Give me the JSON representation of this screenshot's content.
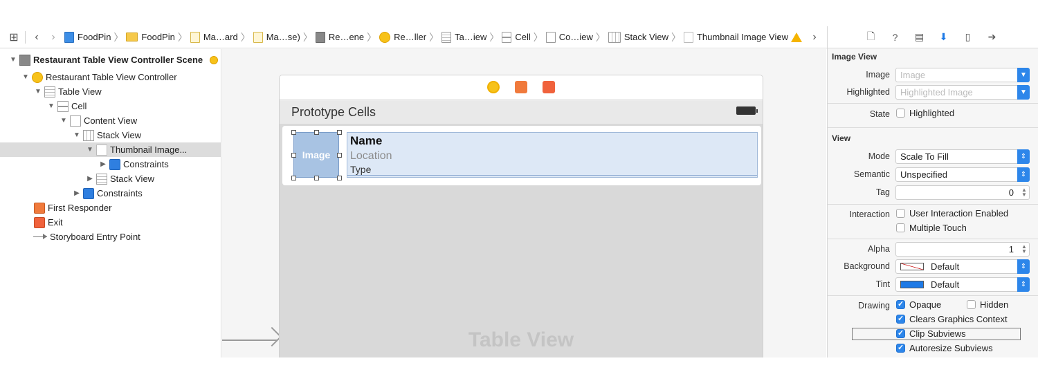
{
  "breadcrumbs": [
    "FoodPin",
    "FoodPin",
    "Ma…ard",
    "Ma…se)",
    "Re…ene",
    "Re…ller",
    "Ta…iew",
    "Cell",
    "Co…iew",
    "Stack View",
    "Thumbnail Image View"
  ],
  "outline": {
    "items": [
      {
        "label": "Restaurant Table View Controller Scene"
      },
      {
        "label": "Restaurant Table View Controller"
      },
      {
        "label": "Table View"
      },
      {
        "label": "Cell"
      },
      {
        "label": "Content View"
      },
      {
        "label": "Stack View"
      },
      {
        "label": "Thumbnail Image..."
      },
      {
        "label": "Constraints"
      },
      {
        "label": "Stack View"
      },
      {
        "label": "Constraints"
      },
      {
        "label": "First Responder"
      },
      {
        "label": "Exit"
      },
      {
        "label": "Storyboard Entry Point"
      }
    ]
  },
  "canvas": {
    "prototype_header": "Prototype Cells",
    "thumb_label": "Image",
    "name_label": "Name",
    "location_label": "Location",
    "type_label": "Type",
    "table_view_label": "Table View"
  },
  "inspector": {
    "image_view": {
      "title": "Image View",
      "image_label": "Image",
      "image_placeholder": "Image",
      "highlighted_label": "Highlighted",
      "highlighted_placeholder": "Highlighted Image",
      "state_label": "State",
      "state_option": "Highlighted"
    },
    "view": {
      "title": "View",
      "mode_label": "Mode",
      "mode_value": "Scale To Fill",
      "semantic_label": "Semantic",
      "semantic_value": "Unspecified",
      "tag_label": "Tag",
      "tag_value": "0",
      "interaction_label": "Interaction",
      "user_interaction": "User Interaction Enabled",
      "multiple_touch": "Multiple Touch",
      "alpha_label": "Alpha",
      "alpha_value": "1",
      "background_label": "Background",
      "background_value": "Default",
      "tint_label": "Tint",
      "tint_value": "Default",
      "drawing_label": "Drawing",
      "opaque": "Opaque",
      "hidden": "Hidden",
      "clears_graphics": "Clears Graphics Context",
      "clip_subviews": "Clip Subviews",
      "autoresize": "Autoresize Subviews"
    }
  },
  "colors": {
    "accent": "#2d86ea",
    "selection": "#dcdcdc",
    "tint_swatch": "#1e7ae6"
  }
}
